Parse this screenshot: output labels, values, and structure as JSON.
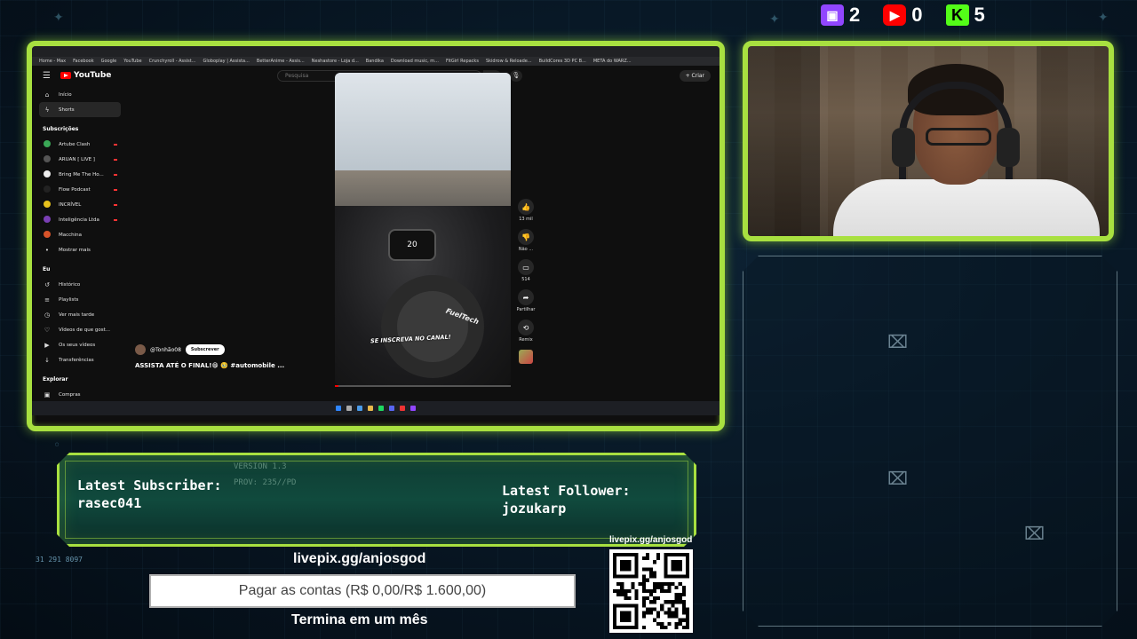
{
  "counters": {
    "twitch": {
      "icon": "twitch-icon",
      "value": "2",
      "color": "#9146ff"
    },
    "youtube": {
      "icon": "youtube-icon",
      "value": "0",
      "color": "#ff0000"
    },
    "kick": {
      "icon": "kick-icon",
      "value": "5",
      "color": "#53fc18"
    }
  },
  "browser": {
    "bookmarks": [
      "Home - Max",
      "Facebook",
      "Google",
      "YouTube",
      "Crunchyroll - Assist...",
      "Globoplay | Assista...",
      "BetterAnime - Assis...",
      "Neshastore - Loja d...",
      "Bandika",
      "Download music, m...",
      "FitGirl Repacks",
      "Skidrow & Reloade...",
      "BuildCores 3D PC B...",
      "META do WARZ..."
    ]
  },
  "youtube": {
    "logo": "YouTube",
    "search_placeholder": "Pesquisa",
    "create_label": "Criar",
    "sidebar": {
      "main": [
        {
          "label": "Início",
          "icon": "home-icon",
          "active": false
        },
        {
          "label": "Shorts",
          "icon": "shorts-icon",
          "active": true
        }
      ],
      "subscriptions_title": "Subscrições",
      "subscriptions": [
        {
          "label": "Artube Clash",
          "color": "#3aa856",
          "live": true
        },
        {
          "label": "ARUAN [ LIVE ]",
          "color": "#555555",
          "live": true
        },
        {
          "label": "Bring Me The Ho...",
          "color": "#eeeeee",
          "live": true
        },
        {
          "label": "Flow Podcast",
          "color": "#222222",
          "live": true
        },
        {
          "label": "INCRÍVEL",
          "color": "#e8c21c",
          "live": true
        },
        {
          "label": "Inteligência Ltda",
          "color": "#7a3fb5",
          "live": true
        },
        {
          "label": "Macchina",
          "color": "#d8542a",
          "live": false
        }
      ],
      "show_more": "Mostrar mais",
      "you_title": "Eu",
      "you_items": [
        {
          "label": "Histórico",
          "icon": "history-icon"
        },
        {
          "label": "Playlists",
          "icon": "playlist-icon"
        },
        {
          "label": "Ver mais tarde",
          "icon": "clock-icon"
        },
        {
          "label": "Vídeos de que gost...",
          "icon": "thumbs-up-icon"
        },
        {
          "label": "Os seus vídeos",
          "icon": "video-icon"
        },
        {
          "label": "Transferências",
          "icon": "download-icon"
        }
      ],
      "explore_title": "Explorar",
      "explore_items": [
        {
          "label": "Compras",
          "icon": "bag-icon"
        }
      ]
    },
    "short": {
      "gauge_value": "20",
      "overlay_text": "SE INSCREVA NO CANAL!",
      "brand_text": "FuelTech",
      "channel": "@Tonhão08",
      "subscribe_label": "Subscrever",
      "caption": "ASSISTA ATÉ O FINAL!😁 🥹 #automobile ...",
      "progress": 0.02
    },
    "actions": [
      {
        "icon": "like-icon",
        "label": "13 mil"
      },
      {
        "icon": "dislike-icon",
        "label": "Não ..."
      },
      {
        "icon": "comment-icon",
        "label": "514"
      },
      {
        "icon": "share-icon",
        "label": "Partilhar"
      },
      {
        "icon": "remix-icon",
        "label": "Remix"
      }
    ]
  },
  "latest": {
    "version": "VERSION 1.3",
    "prov": "PROV: 235//PD",
    "subscriber_title": "Latest Subscriber:",
    "subscriber_name": "rasec041",
    "follower_title": "Latest Follower:",
    "follower_name": "jozukarp"
  },
  "donation": {
    "url": "livepix.gg/anjosgod",
    "goal_text": "Pagar as contas (R$ 0,00/R$ 1.600,00)",
    "goal_progress": 0,
    "ends": "Termina em um mês",
    "qr_label": "livepix.gg/anjosgod"
  },
  "side_number": "31 291 8097",
  "colors": {
    "accent": "#a8e040",
    "background": "#081826"
  }
}
